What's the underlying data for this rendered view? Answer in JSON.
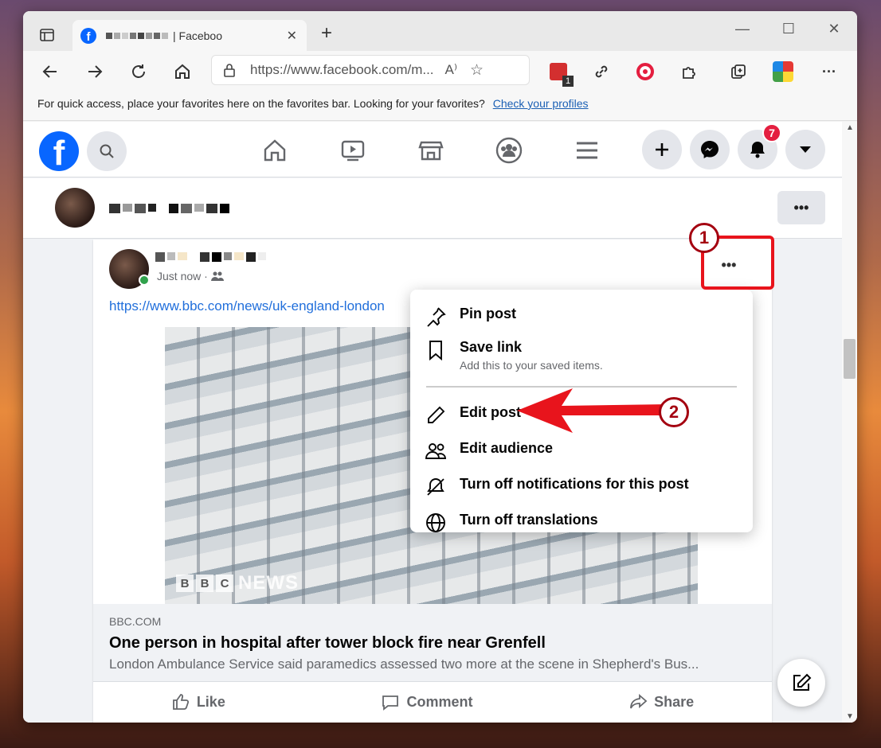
{
  "browser": {
    "tab_title": "| Faceboo",
    "url": "https://www.facebook.com/m...",
    "favorites_bar_text": "For quick access, place your favorites here on the favorites bar. Looking for your favorites?",
    "favorites_bar_link": "Check your profiles",
    "extension_badge": "1"
  },
  "facebook": {
    "notification_count": "7",
    "post": {
      "time": "Just now ·",
      "link": "https://www.bbc.com/news/uk-england-london",
      "image_watermark_letters": [
        "B",
        "B",
        "C"
      ],
      "image_watermark_word": "NEWS",
      "preview_domain": "BBC.COM",
      "preview_title": "One person in hospital after tower block fire near Grenfell",
      "preview_description": "London Ambulance Service said paramedics assessed two more at the scene in Shepherd's Bus...",
      "more_label": "•••",
      "actions": [
        {
          "label": "Like",
          "icon": "thumbs-up-icon"
        },
        {
          "label": "Comment",
          "icon": "comment-icon"
        },
        {
          "label": "Share",
          "icon": "share-icon"
        }
      ]
    },
    "profile_more_label": "•••",
    "menu": {
      "pin_post": "Pin post",
      "save_link": "Save link",
      "save_link_sub": "Add this to your saved items.",
      "edit_post": "Edit post",
      "edit_audience": "Edit audience",
      "turn_off_notifications": "Turn off notifications for this post",
      "turn_off_translations": "Turn off translations"
    }
  },
  "annotations": {
    "step1": "1",
    "step2": "2",
    "accent_color": "#e8141c"
  }
}
